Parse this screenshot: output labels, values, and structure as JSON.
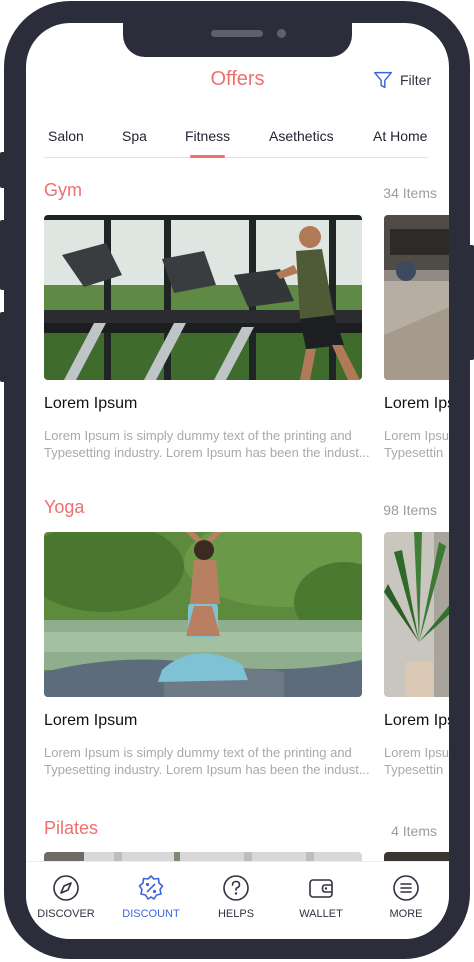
{
  "header": {
    "title": "Offers",
    "filter_label": "Filter",
    "filter_icon": "funnel-icon"
  },
  "tabs": [
    {
      "label": "Salon"
    },
    {
      "label": "Spa"
    },
    {
      "label": "Fitness",
      "active": true
    },
    {
      "label": "Asethetics"
    },
    {
      "label": "At Home"
    }
  ],
  "sections": [
    {
      "title": "Gym",
      "count": "34 Items",
      "card": {
        "title": "Lorem Ipsum",
        "desc_line1": "Lorem Ipsum is simply dummy text of the printing and",
        "desc_line2": "Typesetting industry. Lorem Ipsum has been the indust..."
      },
      "peek": {
        "title": "Lorem Ips",
        "desc_line1": "Lorem Ipsu",
        "desc_line2": "Typesettin"
      }
    },
    {
      "title": "Yoga",
      "count": "98 Items",
      "card": {
        "title": "Lorem Ipsum",
        "desc_line1": "Lorem Ipsum is simply dummy text of the printing and",
        "desc_line2": "Typesetting industry. Lorem Ipsum has been the indust..."
      },
      "peek": {
        "title": "Lorem Ips",
        "desc_line1": "Lorem Ipsu",
        "desc_line2": "Typesettin"
      }
    },
    {
      "title": "Pilates",
      "count": "4 Items"
    }
  ],
  "bottom_nav": [
    {
      "label": "DISCOVER",
      "icon": "compass-icon"
    },
    {
      "label": "DISCOUNT",
      "icon": "discount-badge-icon",
      "active": true
    },
    {
      "label": "HELPS",
      "icon": "help-icon"
    },
    {
      "label": "WALLET",
      "icon": "wallet-icon"
    },
    {
      "label": "MORE",
      "icon": "menu-icon"
    }
  ],
  "colors": {
    "accent": "#ef6f6f",
    "active_nav": "#3e63e0",
    "frame": "#2b2e3a"
  }
}
